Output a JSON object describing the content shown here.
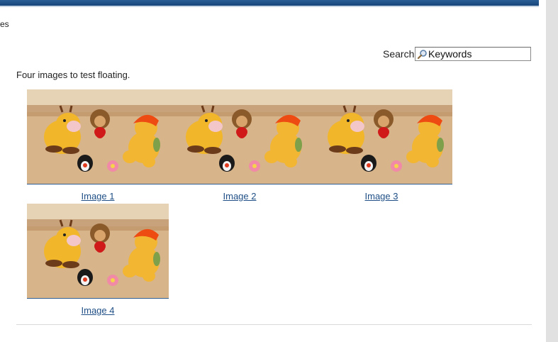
{
  "header": {
    "crumb_fragment": "es"
  },
  "search": {
    "label": "Search",
    "value": "Keywords"
  },
  "content": {
    "intro": "Four images to test floating.",
    "images": [
      {
        "caption": "Image 1"
      },
      {
        "caption": "Image 2"
      },
      {
        "caption": "Image 3"
      },
      {
        "caption": "Image 4"
      }
    ]
  },
  "colors": {
    "topbar": "#16457a",
    "link": "#1f4f86"
  }
}
